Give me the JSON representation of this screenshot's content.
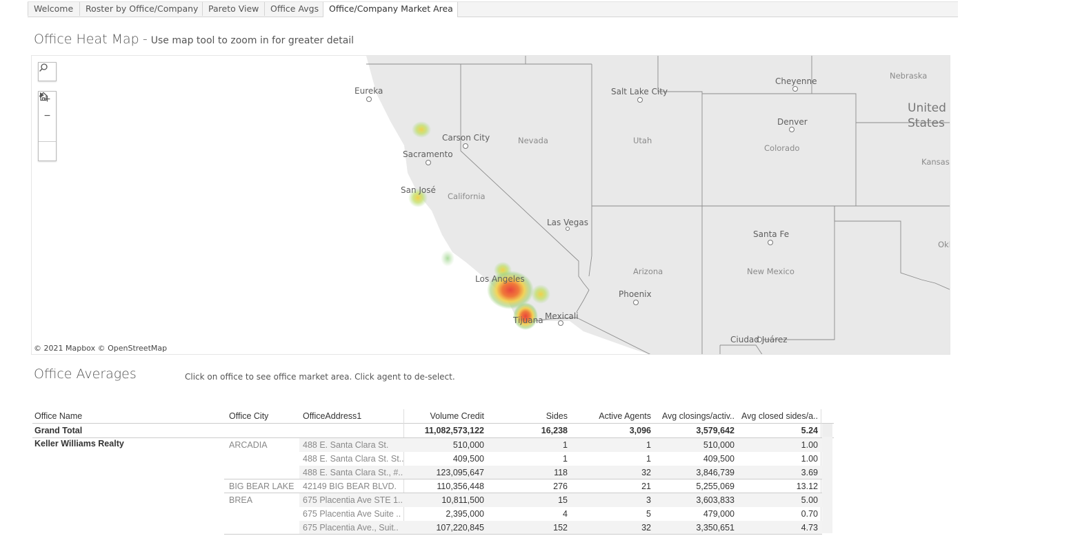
{
  "tabs": [
    {
      "label": "Welcome"
    },
    {
      "label": "Roster by Office/Company"
    },
    {
      "label": "Pareto View"
    },
    {
      "label": "Office Avgs"
    },
    {
      "label": "Office/Company Market Area"
    }
  ],
  "heatmap": {
    "title": "Office Heat Map",
    "separator": "-",
    "subtitle": "Use map tool to zoom in for greater detail",
    "attribution": "© 2021 Mapbox  © OpenStreetMap",
    "labels": {
      "eureka": "Eureka",
      "carson_city": "Carson City",
      "sacramento": "Sacramento",
      "san_jose": "San José",
      "california": "California",
      "nevada": "Nevada",
      "salt_lake_city": "Salt Lake City",
      "utah": "Utah",
      "las_vegas": "Las Vegas",
      "arizona": "Arizona",
      "phoenix": "Phoenix",
      "los_angeles": "Los Angeles",
      "tijuana": "Tijuana",
      "mexicali": "Mexicali",
      "cheyenne": "Cheyenne",
      "nebraska": "Nebraska",
      "united_states": "United States",
      "denver": "Denver",
      "colorado": "Colorado",
      "kansas": "Kansas",
      "santa_fe": "Santa Fe",
      "new_mexico": "New Mexico",
      "okl": "Okl",
      "ciudad_juarez": "Ciudad Juárez"
    },
    "tools": {
      "search": "search-icon",
      "zoom_in": "plus-icon",
      "zoom_out": "minus-icon",
      "home": "home-icon",
      "play": "play-icon"
    }
  },
  "averages": {
    "title": "Office Averages",
    "note": "Click on office to see office market area. Click agent to de-select.",
    "columns": [
      "Office Name",
      "Office City",
      "OfficeAddress1",
      "Volume Credit",
      "Sides",
      "Active Agents",
      "Avg closings/activ..",
      "Avg closed sides/a.."
    ],
    "grand_total": {
      "label": "Grand Total",
      "volume": "11,082,573,122",
      "sides": "16,238",
      "agents": "3,096",
      "avg_closings": "3,579,642",
      "avg_sides": "5.24"
    },
    "office_name": "Keller Williams Realty",
    "rows": [
      {
        "city": "ARCADIA",
        "address": "488 E. Santa Clara St.",
        "volume": "510,000",
        "sides": "1",
        "agents": "1",
        "avg_closings": "510,000",
        "avg_sides": "1.00"
      },
      {
        "city": "",
        "address": "488 E. Santa Clara St. St..",
        "volume": "409,500",
        "sides": "1",
        "agents": "1",
        "avg_closings": "409,500",
        "avg_sides": "1.00"
      },
      {
        "city": "",
        "address": "488 E. Santa Clara St., #..",
        "volume": "123,095,647",
        "sides": "118",
        "agents": "32",
        "avg_closings": "3,846,739",
        "avg_sides": "3.69"
      },
      {
        "city": "BIG BEAR LAKE",
        "address": "42149 BIG BEAR BLVD.",
        "volume": "110,356,448",
        "sides": "276",
        "agents": "21",
        "avg_closings": "5,255,069",
        "avg_sides": "13.12"
      },
      {
        "city": "BREA",
        "address": "675 Placentia Ave STE 1..",
        "volume": "10,811,500",
        "sides": "15",
        "agents": "3",
        "avg_closings": "3,603,833",
        "avg_sides": "5.00"
      },
      {
        "city": "",
        "address": "675 Placentia Ave Suite ..",
        "volume": "2,395,000",
        "sides": "4",
        "agents": "5",
        "avg_closings": "479,000",
        "avg_sides": "0.70"
      },
      {
        "city": "",
        "address": "675 Placentia Ave., Suit..",
        "volume": "107,220,845",
        "sides": "152",
        "agents": "32",
        "avg_closings": "3,350,651",
        "avg_sides": "4.73"
      }
    ]
  }
}
